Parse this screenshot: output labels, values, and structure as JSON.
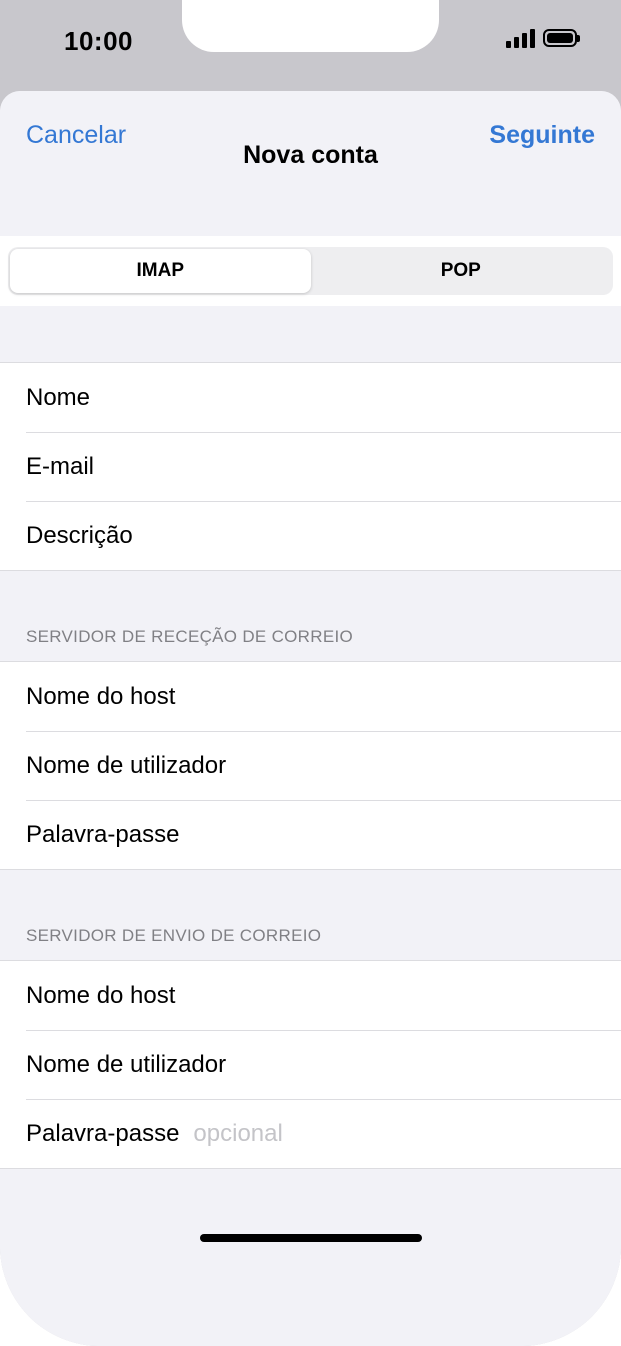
{
  "status_bar": {
    "time": "10:00"
  },
  "nav": {
    "cancel_label": "Cancelar",
    "title": "Nova conta",
    "next_label": "Seguinte"
  },
  "segment": {
    "options": [
      "IMAP",
      "POP"
    ],
    "selected": "IMAP"
  },
  "account": {
    "name_label": "Nome",
    "email_label": "E-mail",
    "description_label": "Descrição"
  },
  "incoming": {
    "header": "SERVIDOR DE RECEÇÃO DE CORREIO",
    "host_label": "Nome do host",
    "user_label": "Nome de utilizador",
    "password_label": "Palavra-passe"
  },
  "outgoing": {
    "header": "SERVIDOR DE ENVIO DE CORREIO",
    "host_label": "Nome do host",
    "user_label": "Nome de utilizador",
    "password_label": "Palavra-passe",
    "password_placeholder": "opcional"
  },
  "colors": {
    "accent": "#3478d4",
    "background": "#f2f2f7",
    "separator": "#dcdce0",
    "section_header": "#808085",
    "placeholder": "#c4c4c8"
  },
  "icons": [
    "signal-icon",
    "battery-icon"
  ]
}
